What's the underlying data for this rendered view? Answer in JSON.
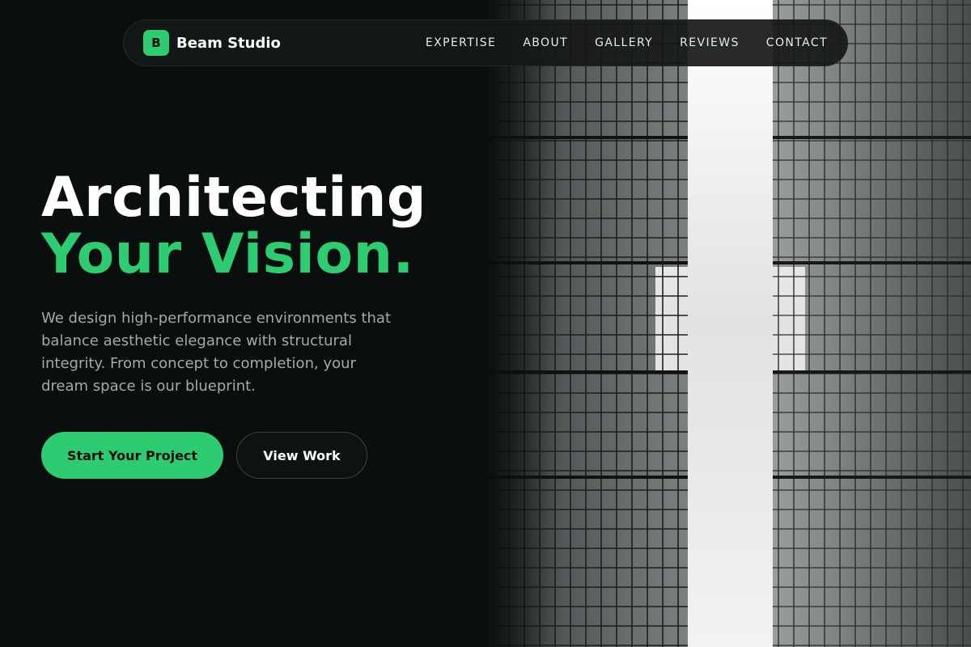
{
  "brand": {
    "logo_letter": "B",
    "name": "Beam Studio"
  },
  "nav": {
    "links": [
      "EXPERTISE",
      "ABOUT",
      "GALLERY",
      "REVIEWS",
      "CONTACT"
    ]
  },
  "hero": {
    "headline_line1": "Architecting",
    "headline_line2": "Your Vision.",
    "subtext": "We design high-performance environments that balance aesthetic elegance with structural integrity. From concept to completion, your dream space is our blueprint.",
    "primary_button": "Start Your Project",
    "secondary_button": "View Work",
    "image_description_icon": "skyscraper-photo"
  },
  "colors": {
    "accent": "#2ecc71",
    "background": "#0b0e0e",
    "nav_background": "#161818",
    "text_primary": "#ffffff",
    "text_muted": "#a3aaa8"
  }
}
